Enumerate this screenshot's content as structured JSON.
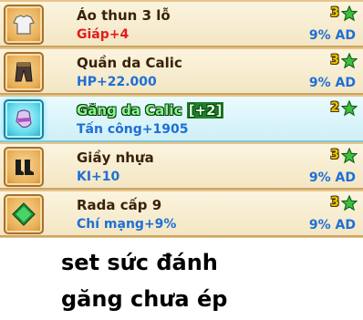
{
  "items": [
    {
      "name": "Áo thun 3 lỗ",
      "stat": "Giáp+4",
      "ad": "9% AD",
      "level": "3",
      "icon": "shirt-icon"
    },
    {
      "name": "Quần da Calic",
      "stat": "HP+22.000",
      "ad": "9% AD",
      "level": "3",
      "icon": "pants-icon"
    },
    {
      "name": "Găng da Calic",
      "name_plus": "[+2]",
      "stat": "Tấn công+1905",
      "ad": "",
      "level": "2",
      "icon": "glove-icon"
    },
    {
      "name": "Giầy nhựa",
      "stat": "KI+10",
      "ad": "9% AD",
      "level": "3",
      "icon": "boots-icon"
    },
    {
      "name": "Rada cấp 9",
      "stat": "Chí mạng+9%",
      "ad": "9% AD",
      "level": "3",
      "icon": "radar-icon"
    }
  ],
  "caption": {
    "line1": "set sức đánh",
    "line2": "găng chưa ép"
  },
  "colors": {
    "stat_red": "#e21c1c",
    "stat_blue": "#1e6fd6",
    "level_yellow": "#e8c400",
    "star_green": "#3fbf3f"
  }
}
